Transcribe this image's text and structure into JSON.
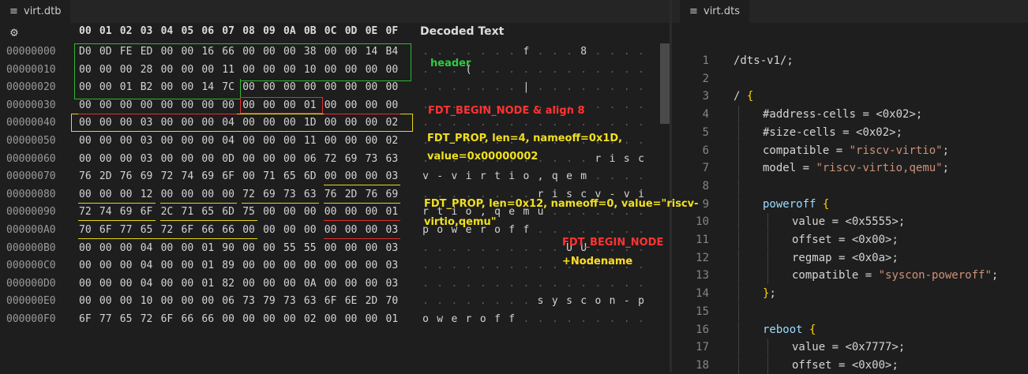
{
  "colors": {
    "box_green": "#2eb82e",
    "box_red": "#e03030",
    "box_yellow": "#e6d817",
    "annot_green": "#2ecc40",
    "annot_red": "#ff3333",
    "annot_yellow": "#f0e020"
  },
  "left_tab": {
    "title": "virt.dtb",
    "icon": "file-lines-icon"
  },
  "right_tab": {
    "title": "virt.dts",
    "icon": "file-lines-icon"
  },
  "hex": {
    "settings_icon": "gear-icon",
    "settings_glyph": "⚙",
    "columns": [
      "00",
      "01",
      "02",
      "03",
      "04",
      "05",
      "06",
      "07",
      "08",
      "09",
      "0A",
      "0B",
      "0C",
      "0D",
      "0E",
      "0F"
    ],
    "decoded_title": "Decoded Text",
    "rows": [
      {
        "offset": "00000000",
        "bytes": [
          "D0",
          "0D",
          "FE",
          "ED",
          "00",
          "00",
          "16",
          "66",
          "00",
          "00",
          "00",
          "38",
          "00",
          "00",
          "14",
          "B4"
        ],
        "ascii": [
          ".",
          ".",
          ".",
          ".",
          ".",
          ".",
          ".",
          "f",
          ".",
          ".",
          ".",
          "8",
          ".",
          ".",
          ".",
          "."
        ]
      },
      {
        "offset": "00000010",
        "bytes": [
          "00",
          "00",
          "00",
          "28",
          "00",
          "00",
          "00",
          "11",
          "00",
          "00",
          "00",
          "10",
          "00",
          "00",
          "00",
          "00"
        ],
        "ascii": [
          ".",
          ".",
          ".",
          "(",
          ".",
          ".",
          ".",
          ".",
          ".",
          ".",
          ".",
          ".",
          ".",
          ".",
          ".",
          "."
        ]
      },
      {
        "offset": "00000020",
        "bytes": [
          "00",
          "00",
          "01",
          "B2",
          "00",
          "00",
          "14",
          "7C",
          "00",
          "00",
          "00",
          "00",
          "00",
          "00",
          "00",
          "00"
        ],
        "ascii": [
          ".",
          ".",
          ".",
          ".",
          ".",
          ".",
          ".",
          "|",
          ".",
          ".",
          ".",
          ".",
          ".",
          ".",
          ".",
          "."
        ]
      },
      {
        "offset": "00000030",
        "bytes": [
          "00",
          "00",
          "00",
          "00",
          "00",
          "00",
          "00",
          "00",
          "00",
          "00",
          "00",
          "01",
          "00",
          "00",
          "00",
          "00"
        ],
        "ascii": [
          ".",
          ".",
          ".",
          ".",
          ".",
          ".",
          ".",
          ".",
          ".",
          ".",
          ".",
          ".",
          ".",
          ".",
          ".",
          "."
        ]
      },
      {
        "offset": "00000040",
        "bytes": [
          "00",
          "00",
          "00",
          "03",
          "00",
          "00",
          "00",
          "04",
          "00",
          "00",
          "00",
          "1D",
          "00",
          "00",
          "00",
          "02"
        ],
        "ascii": [
          ".",
          ".",
          ".",
          ".",
          ".",
          ".",
          ".",
          ".",
          ".",
          ".",
          ".",
          ".",
          ".",
          ".",
          ".",
          "."
        ]
      },
      {
        "offset": "00000050",
        "bytes": [
          "00",
          "00",
          "00",
          "03",
          "00",
          "00",
          "00",
          "04",
          "00",
          "00",
          "00",
          "11",
          "00",
          "00",
          "00",
          "02"
        ],
        "ascii": [
          ".",
          ".",
          ".",
          ".",
          ".",
          ".",
          ".",
          ".",
          ".",
          ".",
          ".",
          ".",
          ".",
          ".",
          ".",
          "."
        ]
      },
      {
        "offset": "00000060",
        "bytes": [
          "00",
          "00",
          "00",
          "03",
          "00",
          "00",
          "00",
          "0D",
          "00",
          "00",
          "00",
          "06",
          "72",
          "69",
          "73",
          "63"
        ],
        "ascii": [
          ".",
          ".",
          ".",
          ".",
          ".",
          ".",
          ".",
          ".",
          ".",
          ".",
          ".",
          ".",
          "r",
          "i",
          "s",
          "c"
        ]
      },
      {
        "offset": "00000070",
        "bytes": [
          "76",
          "2D",
          "76",
          "69",
          "72",
          "74",
          "69",
          "6F",
          "00",
          "71",
          "65",
          "6D",
          "00",
          "00",
          "00",
          "03"
        ],
        "ascii": [
          "v",
          "-",
          "v",
          "i",
          "r",
          "t",
          "i",
          "o",
          ",",
          "q",
          "e",
          "m",
          ".",
          ".",
          ".",
          "."
        ]
      },
      {
        "offset": "00000080",
        "bytes": [
          "00",
          "00",
          "00",
          "12",
          "00",
          "00",
          "00",
          "00",
          "72",
          "69",
          "73",
          "63",
          "76",
          "2D",
          "76",
          "69"
        ],
        "ascii": [
          ".",
          ".",
          ".",
          ".",
          ".",
          ".",
          ".",
          ".",
          "r",
          "i",
          "s",
          "c",
          "v",
          "-",
          "v",
          "i"
        ]
      },
      {
        "offset": "00000090",
        "bytes": [
          "72",
          "74",
          "69",
          "6F",
          "2C",
          "71",
          "65",
          "6D",
          "75",
          "00",
          "00",
          "00",
          "00",
          "00",
          "00",
          "01"
        ],
        "ascii": [
          "r",
          "t",
          "i",
          "o",
          ",",
          "q",
          "e",
          "m",
          "u",
          ".",
          ".",
          ".",
          ".",
          ".",
          ".",
          "."
        ]
      },
      {
        "offset": "000000A0",
        "bytes": [
          "70",
          "6F",
          "77",
          "65",
          "72",
          "6F",
          "66",
          "66",
          "00",
          "00",
          "00",
          "00",
          "00",
          "00",
          "00",
          "03"
        ],
        "ascii": [
          "p",
          "o",
          "w",
          "e",
          "r",
          "o",
          "f",
          "f",
          ".",
          ".",
          ".",
          ".",
          ".",
          ".",
          ".",
          "."
        ]
      },
      {
        "offset": "000000B0",
        "bytes": [
          "00",
          "00",
          "00",
          "04",
          "00",
          "00",
          "01",
          "90",
          "00",
          "00",
          "55",
          "55",
          "00",
          "00",
          "00",
          "03"
        ],
        "ascii": [
          ".",
          ".",
          ".",
          ".",
          ".",
          ".",
          ".",
          ".",
          ".",
          ".",
          "U",
          "U",
          ".",
          ".",
          ".",
          "."
        ]
      },
      {
        "offset": "000000C0",
        "bytes": [
          "00",
          "00",
          "00",
          "04",
          "00",
          "00",
          "01",
          "89",
          "00",
          "00",
          "00",
          "00",
          "00",
          "00",
          "00",
          "03"
        ],
        "ascii": [
          ".",
          ".",
          ".",
          ".",
          ".",
          ".",
          ".",
          ".",
          ".",
          ".",
          ".",
          ".",
          ".",
          ".",
          ".",
          "."
        ]
      },
      {
        "offset": "000000D0",
        "bytes": [
          "00",
          "00",
          "00",
          "04",
          "00",
          "00",
          "01",
          "82",
          "00",
          "00",
          "00",
          "0A",
          "00",
          "00",
          "00",
          "03"
        ],
        "ascii": [
          ".",
          ".",
          ".",
          ".",
          ".",
          ".",
          ".",
          ".",
          ".",
          ".",
          ".",
          ".",
          ".",
          ".",
          ".",
          "."
        ]
      },
      {
        "offset": "000000E0",
        "bytes": [
          "00",
          "00",
          "00",
          "10",
          "00",
          "00",
          "00",
          "06",
          "73",
          "79",
          "73",
          "63",
          "6F",
          "6E",
          "2D",
          "70"
        ],
        "ascii": [
          ".",
          ".",
          ".",
          ".",
          ".",
          ".",
          ".",
          ".",
          "s",
          "y",
          "s",
          "c",
          "o",
          "n",
          "-",
          "p"
        ]
      },
      {
        "offset": "000000F0",
        "bytes": [
          "6F",
          "77",
          "65",
          "72",
          "6F",
          "66",
          "66",
          "00",
          "00",
          "00",
          "00",
          "02",
          "00",
          "00",
          "00",
          "01"
        ],
        "ascii": [
          "o",
          "w",
          "e",
          "r",
          "o",
          "f",
          "f",
          ".",
          ".",
          ".",
          ".",
          ".",
          ".",
          ".",
          ".",
          "."
        ]
      }
    ],
    "annotations": {
      "header": "header",
      "begin_node_align": "FDT_BEGIN_NODE & align 8",
      "prop1_line1": "FDT_PROP, len=4, nameoff=0x1D,",
      "prop1_line2": "value=0x00000002",
      "prop2_line1": "FDT_PROP, len=0x12, nameoff=0, value=\"riscv-",
      "prop2_line2": "virtio,qemu\"",
      "begin_node": "FDT_BEGIN_NODE",
      "nodename": "+Nodename"
    }
  },
  "dts": {
    "lines": [
      {
        "num": "1",
        "indent": 0,
        "tokens": [
          {
            "t": "/dts-v1/;",
            "c": "plain"
          }
        ]
      },
      {
        "num": "2",
        "indent": 0,
        "tokens": []
      },
      {
        "num": "3",
        "indent": 0,
        "tokens": [
          {
            "t": "/ ",
            "c": "plain"
          },
          {
            "t": "{",
            "c": "brace"
          }
        ]
      },
      {
        "num": "4",
        "indent": 1,
        "tokens": [
          {
            "t": "#address-cells",
            "c": "plain"
          },
          {
            "t": " = ",
            "c": "plain"
          },
          {
            "t": "<0x02>;",
            "c": "plain"
          }
        ]
      },
      {
        "num": "5",
        "indent": 1,
        "tokens": [
          {
            "t": "#size-cells",
            "c": "plain"
          },
          {
            "t": " = ",
            "c": "plain"
          },
          {
            "t": "<0x02>;",
            "c": "plain"
          }
        ]
      },
      {
        "num": "6",
        "indent": 1,
        "tokens": [
          {
            "t": "compatible",
            "c": "plain"
          },
          {
            "t": " = ",
            "c": "plain"
          },
          {
            "t": "\"riscv-virtio\"",
            "c": "str"
          },
          {
            "t": ";",
            "c": "plain"
          }
        ]
      },
      {
        "num": "7",
        "indent": 1,
        "tokens": [
          {
            "t": "model",
            "c": "plain"
          },
          {
            "t": " = ",
            "c": "plain"
          },
          {
            "t": "\"riscv-virtio,qemu\"",
            "c": "str"
          },
          {
            "t": ";",
            "c": "plain"
          }
        ]
      },
      {
        "num": "8",
        "indent": 1,
        "tokens": []
      },
      {
        "num": "9",
        "indent": 1,
        "tokens": [
          {
            "t": "poweroff ",
            "c": "id"
          },
          {
            "t": "{",
            "c": "brace"
          }
        ]
      },
      {
        "num": "10",
        "indent": 2,
        "tokens": [
          {
            "t": "value",
            "c": "plain"
          },
          {
            "t": " = ",
            "c": "plain"
          },
          {
            "t": "<0x5555>;",
            "c": "plain"
          }
        ]
      },
      {
        "num": "11",
        "indent": 2,
        "tokens": [
          {
            "t": "offset",
            "c": "plain"
          },
          {
            "t": " = ",
            "c": "plain"
          },
          {
            "t": "<0x00>;",
            "c": "plain"
          }
        ]
      },
      {
        "num": "12",
        "indent": 2,
        "tokens": [
          {
            "t": "regmap",
            "c": "plain"
          },
          {
            "t": " = ",
            "c": "plain"
          },
          {
            "t": "<0x0a>;",
            "c": "plain"
          }
        ]
      },
      {
        "num": "13",
        "indent": 2,
        "tokens": [
          {
            "t": "compatible",
            "c": "plain"
          },
          {
            "t": " = ",
            "c": "plain"
          },
          {
            "t": "\"syscon-poweroff\"",
            "c": "str"
          },
          {
            "t": ";",
            "c": "plain"
          }
        ]
      },
      {
        "num": "14",
        "indent": 1,
        "tokens": [
          {
            "t": "}",
            "c": "brace"
          },
          {
            "t": ";",
            "c": "plain"
          }
        ]
      },
      {
        "num": "15",
        "indent": 1,
        "tokens": []
      },
      {
        "num": "16",
        "indent": 1,
        "tokens": [
          {
            "t": "reboot ",
            "c": "id"
          },
          {
            "t": "{",
            "c": "brace"
          }
        ]
      },
      {
        "num": "17",
        "indent": 2,
        "tokens": [
          {
            "t": "value",
            "c": "plain"
          },
          {
            "t": " = ",
            "c": "plain"
          },
          {
            "t": "<0x7777>;",
            "c": "plain"
          }
        ]
      },
      {
        "num": "18",
        "indent": 2,
        "tokens": [
          {
            "t": "offset",
            "c": "plain"
          },
          {
            "t": " = ",
            "c": "plain"
          },
          {
            "t": "<0x00>;",
            "c": "plain"
          }
        ]
      }
    ]
  }
}
